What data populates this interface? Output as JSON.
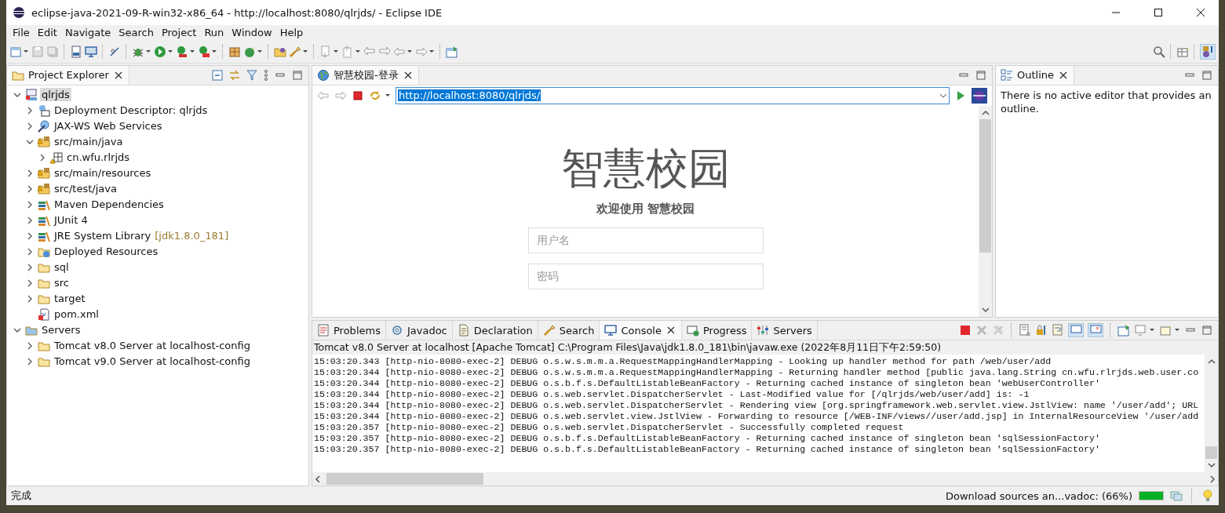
{
  "window": {
    "title": "eclipse-java-2021-09-R-win32-x86_64 - http://localhost:8080/qlrjds/ - Eclipse IDE"
  },
  "menu": [
    "File",
    "Edit",
    "Navigate",
    "Search",
    "Project",
    "Run",
    "Window",
    "Help"
  ],
  "explorer": {
    "tab": {
      "label": "Project Explorer",
      "selected": true
    },
    "tree": [
      {
        "label": "qlrjds",
        "kind": "project",
        "expanded": true,
        "selected": true,
        "children": [
          {
            "label": "Deployment Descriptor: qlrjds",
            "kind": "descriptor",
            "expanded": false,
            "selected": false
          },
          {
            "label": "JAX-WS Web Services",
            "kind": "webservice",
            "expanded": false,
            "selected": false
          },
          {
            "label": "src/main/java",
            "kind": "source",
            "expanded": true,
            "selected": false,
            "children": [
              {
                "label": "cn.wfu.rlrjds",
                "kind": "package",
                "expanded": false,
                "selected": false
              }
            ]
          },
          {
            "label": "src/main/resources",
            "kind": "source",
            "expanded": false,
            "selected": false
          },
          {
            "label": "src/test/java",
            "kind": "source",
            "expanded": false,
            "selected": false
          },
          {
            "label": "Maven Dependencies",
            "kind": "library",
            "expanded": false,
            "selected": false
          },
          {
            "label": "JUnit 4",
            "kind": "library",
            "expanded": false,
            "selected": false
          },
          {
            "label": "JRE System Library",
            "decoration": "[jdk1.8.0_181]",
            "kind": "library",
            "expanded": false,
            "selected": false
          },
          {
            "label": "Deployed Resources",
            "kind": "deployed",
            "expanded": false,
            "selected": false
          },
          {
            "label": "sql",
            "kind": "folder",
            "expanded": false,
            "selected": false
          },
          {
            "label": "src",
            "kind": "folder",
            "expanded": false,
            "selected": false
          },
          {
            "label": "target",
            "kind": "folder",
            "expanded": false,
            "selected": false
          },
          {
            "label": "pom.xml",
            "kind": "xml",
            "selected": false
          }
        ]
      },
      {
        "label": "Servers",
        "kind": "servers",
        "expanded": true,
        "selected": false,
        "children": [
          {
            "label": "Tomcat v8.0 Server at localhost-config",
            "kind": "folder",
            "expanded": false,
            "selected": false
          },
          {
            "label": "Tomcat v9.0 Server at localhost-config",
            "kind": "folder",
            "expanded": false,
            "selected": false
          }
        ]
      }
    ]
  },
  "editor": {
    "tab": {
      "label": "智慧校园-登录",
      "selected": true
    },
    "url": "http://localhost:8080/qlrjds/",
    "heading": "智慧校园",
    "subtitle": "欢迎使用 智慧校园",
    "fields": [
      {
        "placeholder": "用户名"
      },
      {
        "placeholder": "密码"
      }
    ]
  },
  "outline": {
    "tab": {
      "label": "Outline",
      "selected": true
    },
    "message": "There is no active editor that provides an outline."
  },
  "console": {
    "tabs": [
      {
        "label": "Problems",
        "kind": "problems",
        "selected": false
      },
      {
        "label": "Javadoc",
        "kind": "javadoc",
        "selected": false
      },
      {
        "label": "Declaration",
        "kind": "declaration",
        "selected": false
      },
      {
        "label": "Search",
        "kind": "search",
        "selected": false
      },
      {
        "label": "Console",
        "kind": "console",
        "selected": true
      },
      {
        "label": "Progress",
        "kind": "progress",
        "selected": false
      },
      {
        "label": "Servers",
        "kind": "servers",
        "selected": false
      }
    ],
    "header": "Tomcat v8.0 Server at localhost [Apache Tomcat] C:\\Program Files\\Java\\jdk1.8.0_181\\bin\\javaw.exe  (2022年8月11日下午2:59:50)",
    "lines": [
      "15:03:20.343 [http-nio-8080-exec-2] DEBUG o.s.w.s.m.m.a.RequestMappingHandlerMapping - Looking up handler method for path /web/user/add",
      "15:03:20.344 [http-nio-8080-exec-2] DEBUG o.s.w.s.m.m.a.RequestMappingHandlerMapping - Returning handler method [public java.lang.String cn.wfu.rlrjds.web.user.co",
      "15:03:20.344 [http-nio-8080-exec-2] DEBUG o.s.b.f.s.DefaultListableBeanFactory - Returning cached instance of singleton bean 'webUserController'",
      "15:03:20.344 [http-nio-8080-exec-2] DEBUG o.s.web.servlet.DispatcherServlet - Last-Modified value for [/qlrjds/web/user/add] is: -1",
      "15:03:20.344 [http-nio-8080-exec-2] DEBUG o.s.web.servlet.DispatcherServlet - Rendering view [org.springframework.web.servlet.view.JstlView: name '/user/add'; URL",
      "15:03:20.344 [http-nio-8080-exec-2] DEBUG o.s.web.servlet.view.JstlView - Forwarding to resource [/WEB-INF/views//user/add.jsp] in InternalResourceView '/user/add",
      "15:03:20.357 [http-nio-8080-exec-2] DEBUG o.s.web.servlet.DispatcherServlet - Successfully completed request",
      "15:03:20.357 [http-nio-8080-exec-2] DEBUG o.s.b.f.s.DefaultListableBeanFactory - Returning cached instance of singleton bean 'sqlSessionFactory'",
      "15:03:20.357 [http-nio-8080-exec-2] DEBUG o.s.b.f.s.DefaultListableBeanFactory - Returning cached instance of singleton bean 'sqlSessionFactory'"
    ]
  },
  "status_bar": {
    "message": "完成",
    "task": "Download sources an...vadoc: (66%)",
    "level": 1
  }
}
